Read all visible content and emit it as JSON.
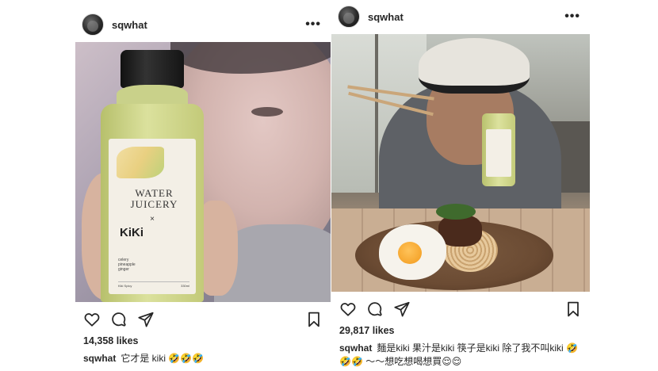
{
  "posts": [
    {
      "username": "sqwhat",
      "likes": "14,358 likes",
      "caption": "它才是 kiki 🤣🤣🤣"
    },
    {
      "username": "sqwhat",
      "likes": "29,817 likes",
      "caption": "麵是kiki 果汁是kiki 筷子是kiki 除了我不叫kiki 🤣🤣🤣 ～～想吃想喝想買😌😌"
    }
  ],
  "bottle_label": {
    "brand_line1": "WATER",
    "brand_line2": "JUICERY",
    "cross": "×",
    "collab": "KiKi",
    "ingredients": "celery\npineapple\nginger",
    "product": "Kiki Spicy",
    "volume": "330ml"
  },
  "icons": [
    "more-icon",
    "heart-icon",
    "comment-icon",
    "share-icon",
    "bookmark-icon"
  ]
}
